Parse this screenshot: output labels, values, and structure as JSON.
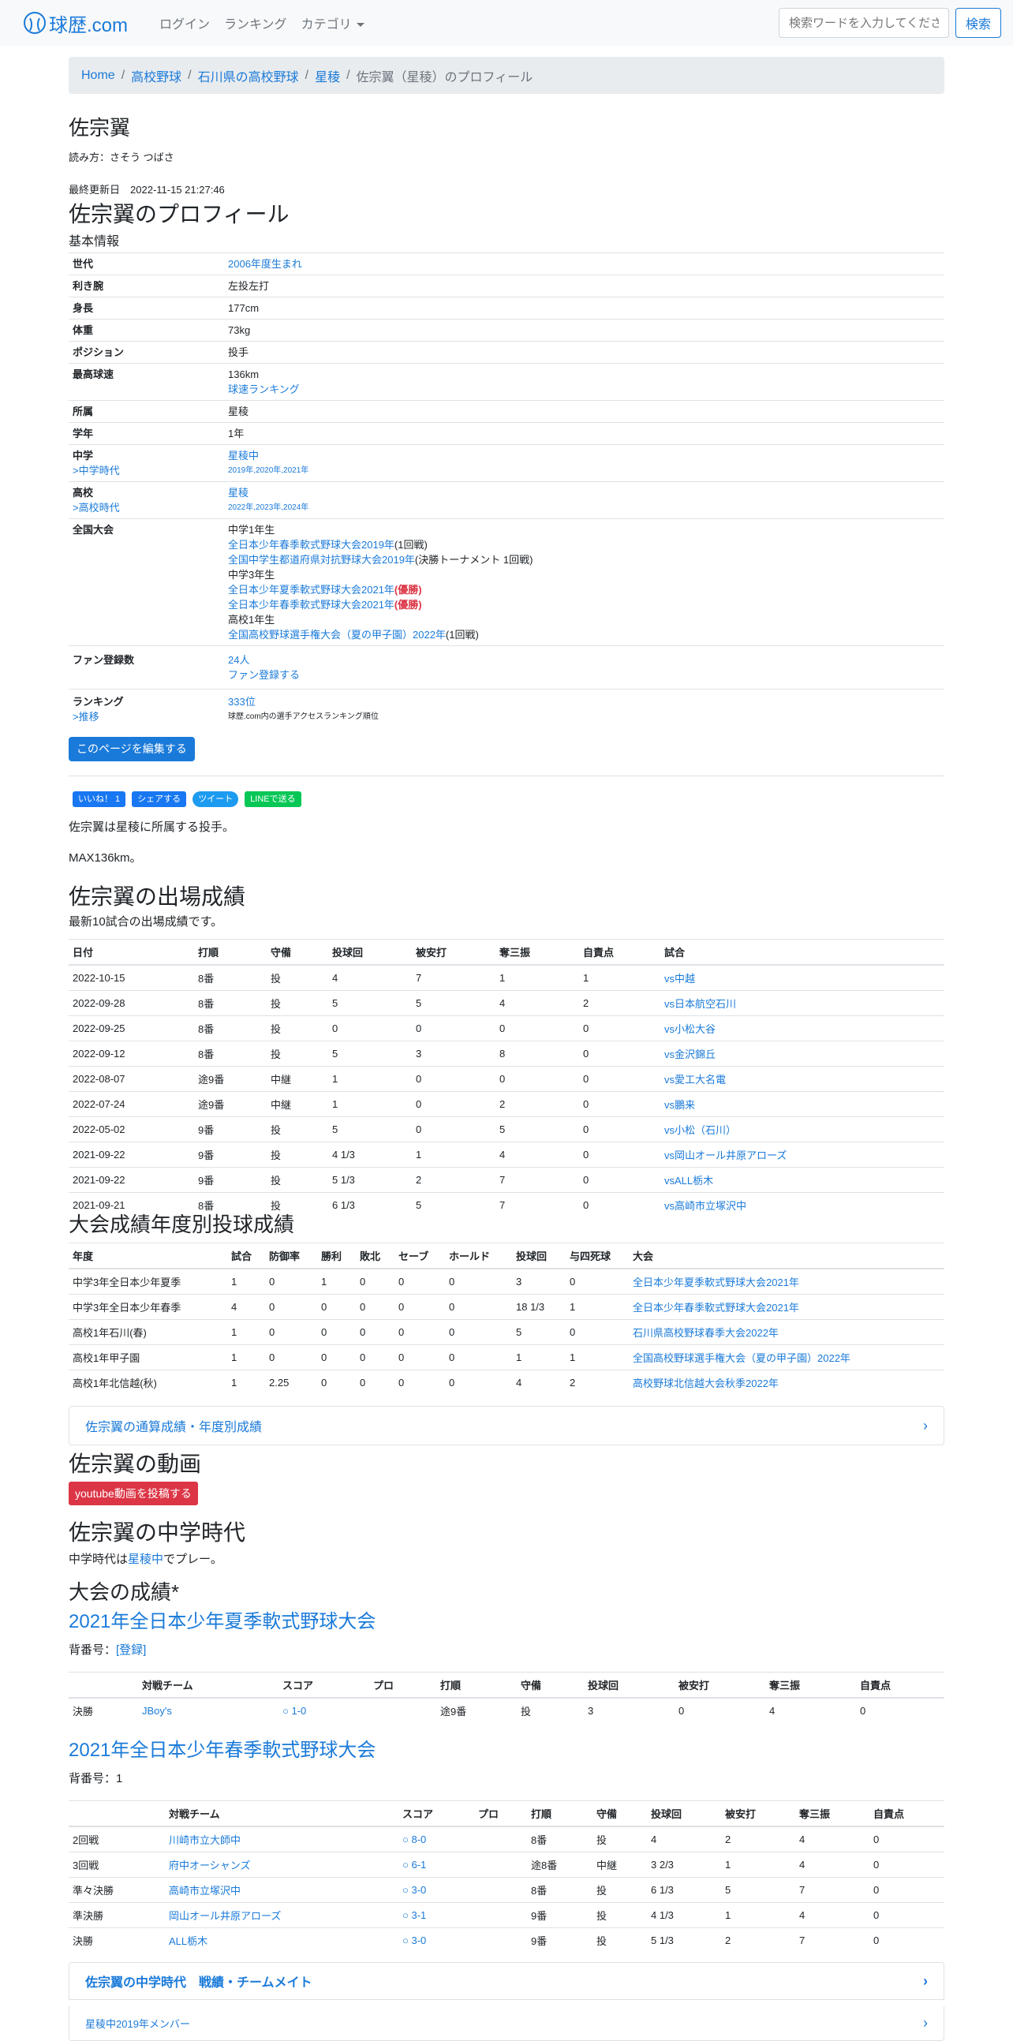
{
  "nav": {
    "brand": "球歴.com",
    "login": "ログイン",
    "ranking": "ランキング",
    "category": "カテゴリ",
    "search_placeholder": "検索ワードを入力してください",
    "search_button": "検索"
  },
  "breadcrumb": [
    "Home",
    "高校野球",
    "石川県の高校野球",
    "星稜",
    "佐宗翼（星稜）のプロフィール"
  ],
  "player": {
    "name": "佐宗翼",
    "reading": "読み方：さそう つばさ",
    "updated_label": "最終更新日",
    "updated": "2022-11-15 21:27:46"
  },
  "profile": {
    "title": "佐宗翼のプロフィール",
    "subtitle": "基本情報",
    "generation_label": "世代",
    "generation": "2006年度生まれ",
    "hand_label": "利き腕",
    "hand": "左投左打",
    "height_label": "身長",
    "height": "177cm",
    "weight_label": "体重",
    "weight": "73kg",
    "position_label": "ポジション",
    "position": "投手",
    "speed_label": "最高球速",
    "speed": "136km",
    "speed_link": "球速ランキング",
    "team_label": "所属",
    "team": "星稜",
    "grade_label": "学年",
    "grade": "1年",
    "jhs_label": "中学",
    "jhs_sub": ">中学時代",
    "jhs": "星稜中",
    "jhs_years": "2019年,2020年,2021年",
    "hs_label": "高校",
    "hs_sub": ">高校時代",
    "hs": "星稜",
    "hs_years": "2022年,2023年,2024年",
    "national_label": "全国大会",
    "national": [
      {
        "head": "中学1年生"
      },
      {
        "link": "全日本少年春季軟式野球大会2019年",
        "note": "(1回戦)"
      },
      {
        "link": "全国中学生都道府県対抗野球大会2019年",
        "note": "(決勝トーナメント 1回戦)"
      },
      {
        "head": "中学3年生"
      },
      {
        "link": "全日本少年夏季軟式野球大会2021年",
        "pre": "(",
        "red": "優勝",
        "post": ")"
      },
      {
        "link": "全日本少年春季軟式野球大会2021年",
        "pre": "(",
        "red": "優勝",
        "post": ")"
      },
      {
        "head": "高校1年生"
      },
      {
        "link": "全国高校野球選手権大会（夏の甲子園）2022年",
        "note": "(1回戦)"
      }
    ],
    "fan_label": "ファン登録数",
    "fan_count": "24人",
    "fan_link": "ファン登録する",
    "rank_label": "ランキング",
    "rank_sub": ">推移",
    "rank": "333位",
    "rank_note": "球歴.com内の選手アクセスランキング順位",
    "edit_button": "このページを編集する"
  },
  "social": {
    "like": "いいね！ 1",
    "share": "シェアする",
    "tweet": "ツイート",
    "line": "LINEで送る"
  },
  "intro": [
    "佐宗翼は星稜に所属する投手。",
    "MAX136km。"
  ],
  "games": {
    "title": "佐宗翼の出場成績",
    "subtitle": "最新10試合の出場成績です。",
    "headers": [
      "日付",
      "打順",
      "守備",
      "投球回",
      "被安打",
      "奪三振",
      "自責点",
      "試合"
    ],
    "rows": [
      [
        "2022-10-15",
        "8番",
        "投",
        "4",
        "7",
        "1",
        "1",
        "vs中越"
      ],
      [
        "2022-09-28",
        "8番",
        "投",
        "5",
        "5",
        "4",
        "2",
        "vs日本航空石川"
      ],
      [
        "2022-09-25",
        "8番",
        "投",
        "0",
        "0",
        "0",
        "0",
        "vs小松大谷"
      ],
      [
        "2022-09-12",
        "8番",
        "投",
        "5",
        "3",
        "8",
        "0",
        "vs金沢錦丘"
      ],
      [
        "2022-08-07",
        "途9番",
        "中継",
        "1",
        "0",
        "0",
        "0",
        "vs愛工大名電"
      ],
      [
        "2022-07-24",
        "途9番",
        "中継",
        "1",
        "0",
        "2",
        "0",
        "vs鵬来"
      ],
      [
        "2022-05-02",
        "9番",
        "投",
        "5",
        "0",
        "5",
        "0",
        "vs小松（石川）"
      ],
      [
        "2021-09-22",
        "9番",
        "投",
        "4 1/3",
        "1",
        "4",
        "0",
        "vs岡山オール井原アローズ"
      ],
      [
        "2021-09-22",
        "9番",
        "投",
        "5 1/3",
        "2",
        "7",
        "0",
        "vsALL栃木"
      ],
      [
        "2021-09-21",
        "8番",
        "投",
        "6 1/3",
        "5",
        "7",
        "0",
        "vs高崎市立塚沢中"
      ]
    ]
  },
  "yearly": {
    "title": "大会成績年度別投球成績",
    "headers": [
      "年度",
      "試合",
      "防御率",
      "勝利",
      "敗北",
      "セーブ",
      "ホールド",
      "投球回",
      "与四死球",
      "大会"
    ],
    "rows": [
      [
        "中学3年全日本少年夏季",
        "1",
        "0",
        "1",
        "0",
        "0",
        "0",
        "3",
        "0",
        "全日本少年夏季軟式野球大会2021年"
      ],
      [
        "中学3年全日本少年春季",
        "4",
        "0",
        "0",
        "0",
        "0",
        "0",
        "18 1/3",
        "1",
        "全日本少年春季軟式野球大会2021年"
      ],
      [
        "高校1年石川(春)",
        "1",
        "0",
        "0",
        "0",
        "0",
        "0",
        "5",
        "0",
        "石川県高校野球春季大会2022年"
      ],
      [
        "高校1年甲子園",
        "1",
        "0",
        "0",
        "0",
        "0",
        "0",
        "1",
        "1",
        "全国高校野球選手権大会（夏の甲子園）2022年"
      ],
      [
        "高校1年北信越(秋)",
        "1",
        "2.25",
        "0",
        "0",
        "0",
        "0",
        "4",
        "2",
        "高校野球北信越大会秋季2022年"
      ]
    ],
    "card": "佐宗翼の通算成績・年度別成績"
  },
  "video": {
    "title": "佐宗翼の動画",
    "button": "youtube動画を投稿する"
  },
  "jhs": {
    "title": "佐宗翼の中学時代",
    "text_pre": "中学時代は",
    "text_link": "星稜中",
    "text_post": "でプレー。",
    "results_title": "大会の成績*",
    "t1": {
      "title": "2021年全日本少年夏季軟式野球大会",
      "number_label": "背番号：",
      "number_link": "[登録]",
      "headers": [
        "",
        "対戦チーム",
        "スコア",
        "プロ",
        "打順",
        "守備",
        "投球回",
        "被安打",
        "奪三振",
        "自責点"
      ],
      "rows": [
        [
          "決勝",
          "JBoy's",
          "○ 1-0",
          "",
          "途9番",
          "投",
          "3",
          "0",
          "4",
          "0"
        ]
      ]
    },
    "t2": {
      "title": "2021年全日本少年春季軟式野球大会",
      "number": "背番号：1",
      "headers": [
        "",
        "対戦チーム",
        "スコア",
        "プロ",
        "打順",
        "守備",
        "投球回",
        "被安打",
        "奪三振",
        "自責点"
      ],
      "rows": [
        [
          "2回戦",
          "川崎市立大師中",
          "○ 8-0",
          "",
          "8番",
          "投",
          "4",
          "2",
          "4",
          "0"
        ],
        [
          "3回戦",
          "府中オーシャンズ",
          "○ 6-1",
          "",
          "途8番",
          "中継",
          "3 2/3",
          "1",
          "4",
          "0"
        ],
        [
          "準々決勝",
          "高崎市立塚沢中",
          "○ 3-0",
          "",
          "8番",
          "投",
          "6 1/3",
          "5",
          "7",
          "0"
        ],
        [
          "準決勝",
          "岡山オール井原アローズ",
          "○ 3-1",
          "",
          "9番",
          "投",
          "4 1/3",
          "1",
          "4",
          "0"
        ],
        [
          "決勝",
          "ALL栃木",
          "○ 3-0",
          "",
          "9番",
          "投",
          "5 1/3",
          "2",
          "7",
          "0"
        ]
      ]
    },
    "card1": "佐宗翼の中学時代　戦績・チームメイト",
    "card2": "星稜中2019年メンバー"
  }
}
